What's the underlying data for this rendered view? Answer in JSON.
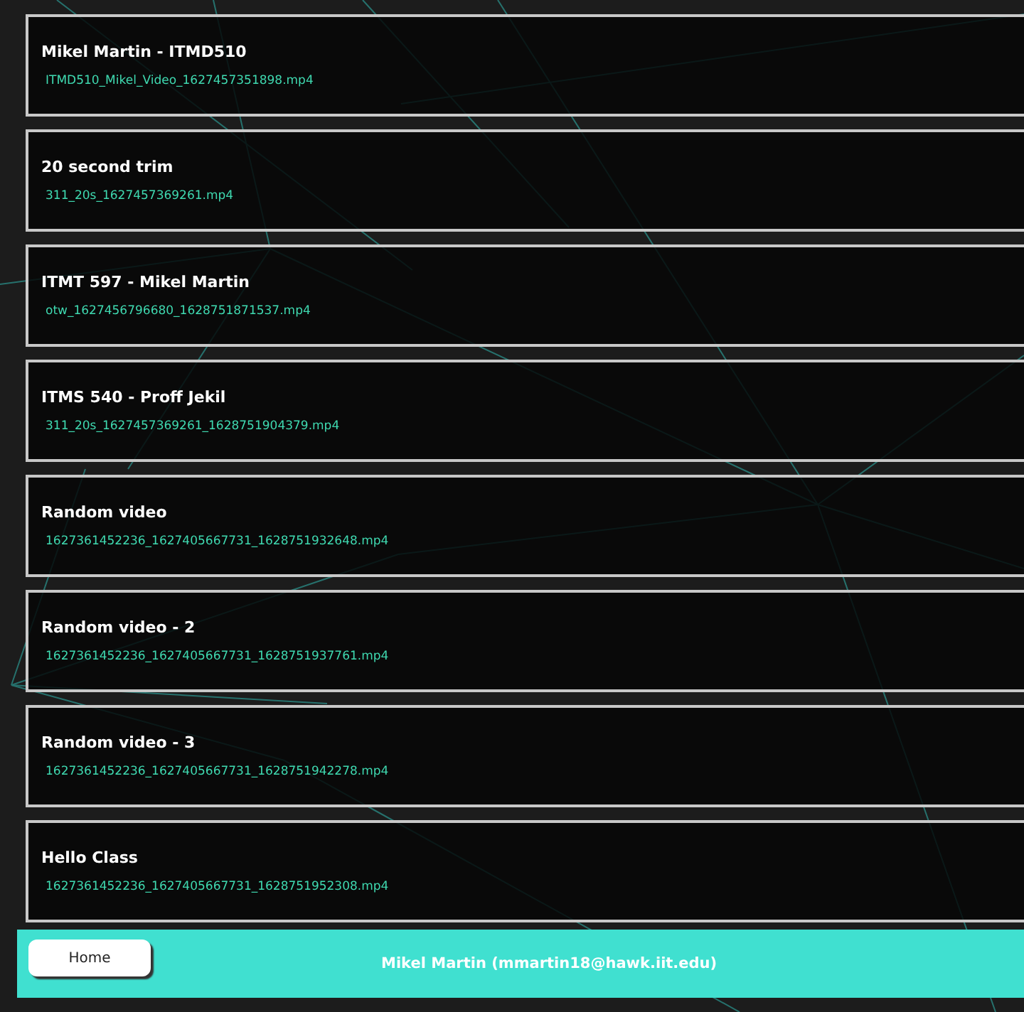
{
  "videos": [
    {
      "title": "Mikel Martin - ITMD510",
      "file": "ITMD510_Mikel_Video_1627457351898.mp4"
    },
    {
      "title": "20 second trim",
      "file": "311_20s_1627457369261.mp4"
    },
    {
      "title": "ITMT 597 - Mikel Martin",
      "file": "otw_1627456796680_1628751871537.mp4"
    },
    {
      "title": "ITMS 540 - Proff Jekil",
      "file": "311_20s_1627457369261_1628751904379.mp4"
    },
    {
      "title": "Random video",
      "file": "1627361452236_1627405667731_1628751932648.mp4"
    },
    {
      "title": "Random video - 2",
      "file": "1627361452236_1627405667731_1628751937761.mp4"
    },
    {
      "title": "Random video - 3",
      "file": "1627361452236_1627405667731_1628751942278.mp4"
    },
    {
      "title": "Hello Class",
      "file": "1627361452236_1627405667731_1628751952308.mp4"
    }
  ],
  "footer": {
    "button": "Home",
    "user": "Mikel Martin (mmartin18@hawk.iit.edu)"
  }
}
